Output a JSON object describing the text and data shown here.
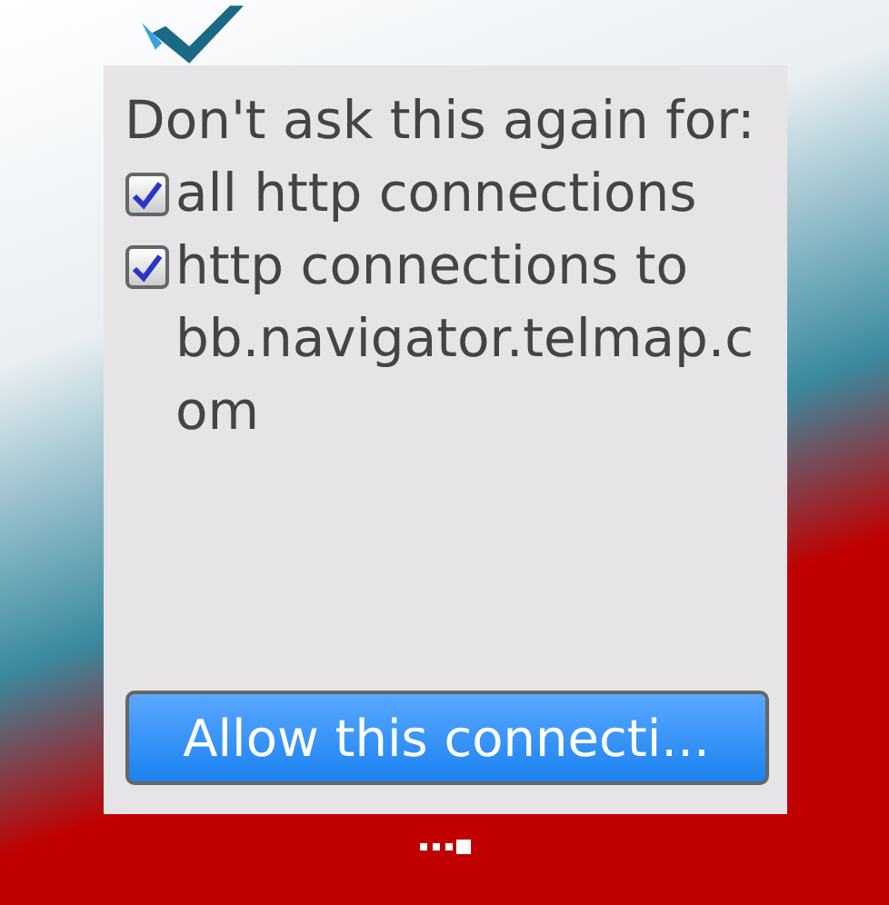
{
  "dialog": {
    "heading": "Don't ask this again for:",
    "options": [
      {
        "label": "all http connections",
        "checked": true
      },
      {
        "label": "http connections to bb.navigator.telmap.com",
        "checked": true
      }
    ],
    "button": "Allow this connecti..."
  }
}
